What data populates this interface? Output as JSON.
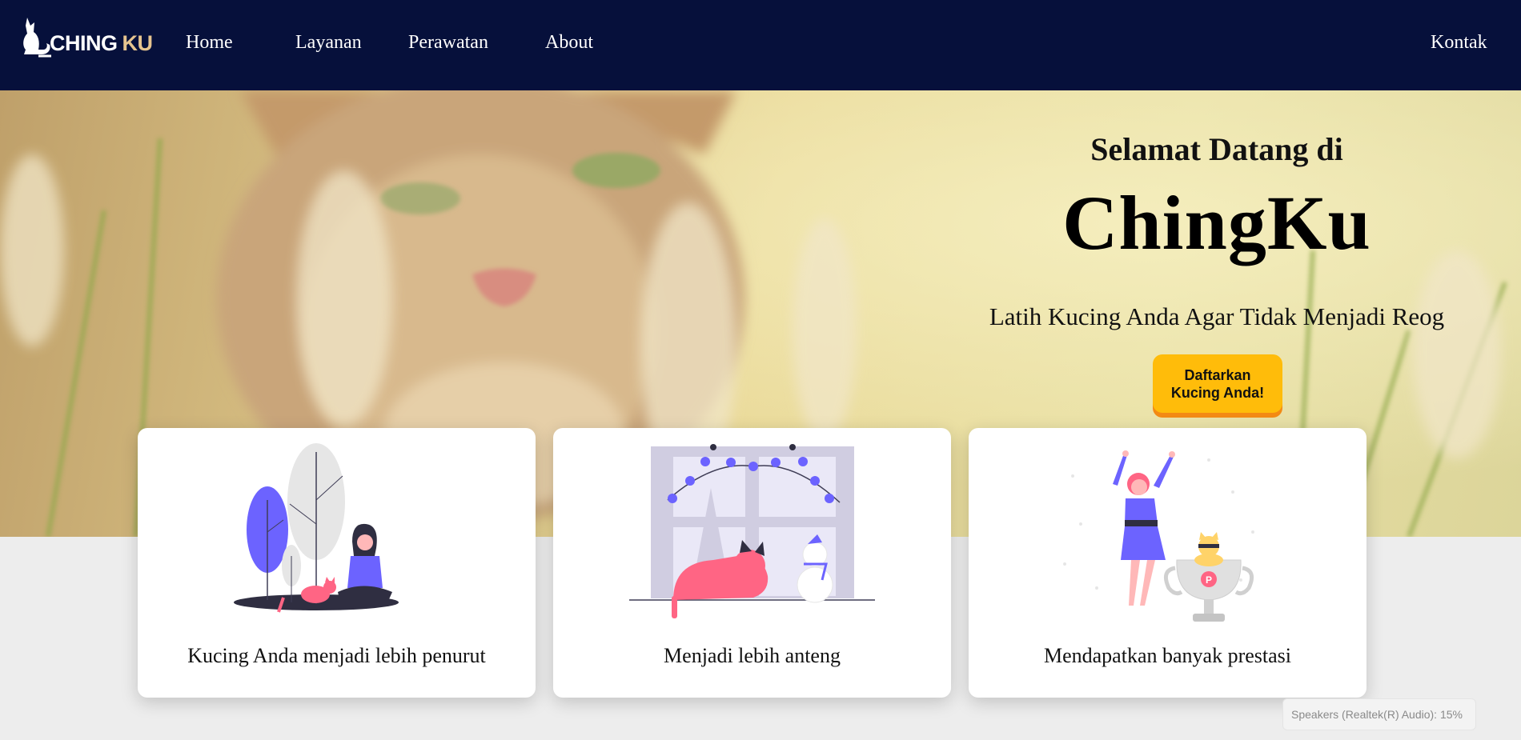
{
  "nav": {
    "logo": {
      "main": "CHING",
      "accent": "KU"
    },
    "links": [
      "Home",
      "Layanan",
      "Perawatan",
      "About"
    ],
    "contact": "Kontak"
  },
  "hero": {
    "welcome": "Selamat Datang di",
    "brand": "ChingKu",
    "tagline": "Latih Kucing Anda Agar Tidak Menjadi Reog",
    "cta": "Daftarkan Kucing Anda!"
  },
  "cards": [
    {
      "caption": "Kucing Anda menjadi lebih penurut",
      "illustration": "girl-with-cat-under-trees"
    },
    {
      "caption": "Menjadi lebih anteng",
      "illustration": "cat-at-winter-window"
    },
    {
      "caption": "Mendapatkan banyak prestasi",
      "illustration": "woman-with-trophy-cat"
    }
  ],
  "toast": {
    "text": "Speakers (Realtek(R) Audio): 15%"
  },
  "colors": {
    "navbar": "#06103b",
    "accent_gold": "#e6c48f",
    "cta": "#ffbc0a",
    "cta_shadow": "#f38a14",
    "illustration_purple": "#6c63ff",
    "illustration_pink": "#ff6584"
  }
}
